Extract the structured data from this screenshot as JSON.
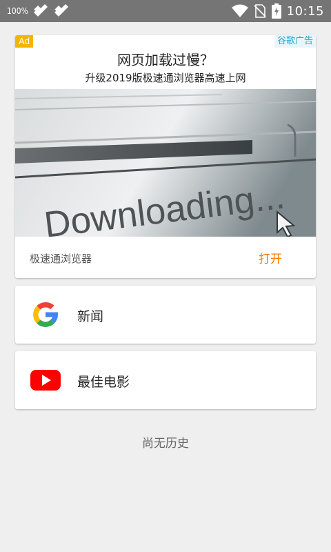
{
  "status_bar": {
    "battery_percent": "100%",
    "time": "10:15",
    "icons": [
      "notification-icon",
      "notification-icon",
      "wifi-icon",
      "no-sim-icon",
      "battery-charging-icon"
    ]
  },
  "ad": {
    "badge": "Ad",
    "choices_label": "谷歌广告",
    "title": "网页加载过慢？",
    "subtitle": "升级2019版极速通浏览器高速上网",
    "image_text": "Downloading...",
    "app_name": "极速通浏览器",
    "cta_label": "打开",
    "cta_color": "#f57c00"
  },
  "shortcuts": [
    {
      "label": "新闻",
      "icon": "google-icon"
    },
    {
      "label": "最佳电影",
      "icon": "youtube-icon"
    }
  ],
  "history": {
    "empty_text": "尚无历史"
  }
}
